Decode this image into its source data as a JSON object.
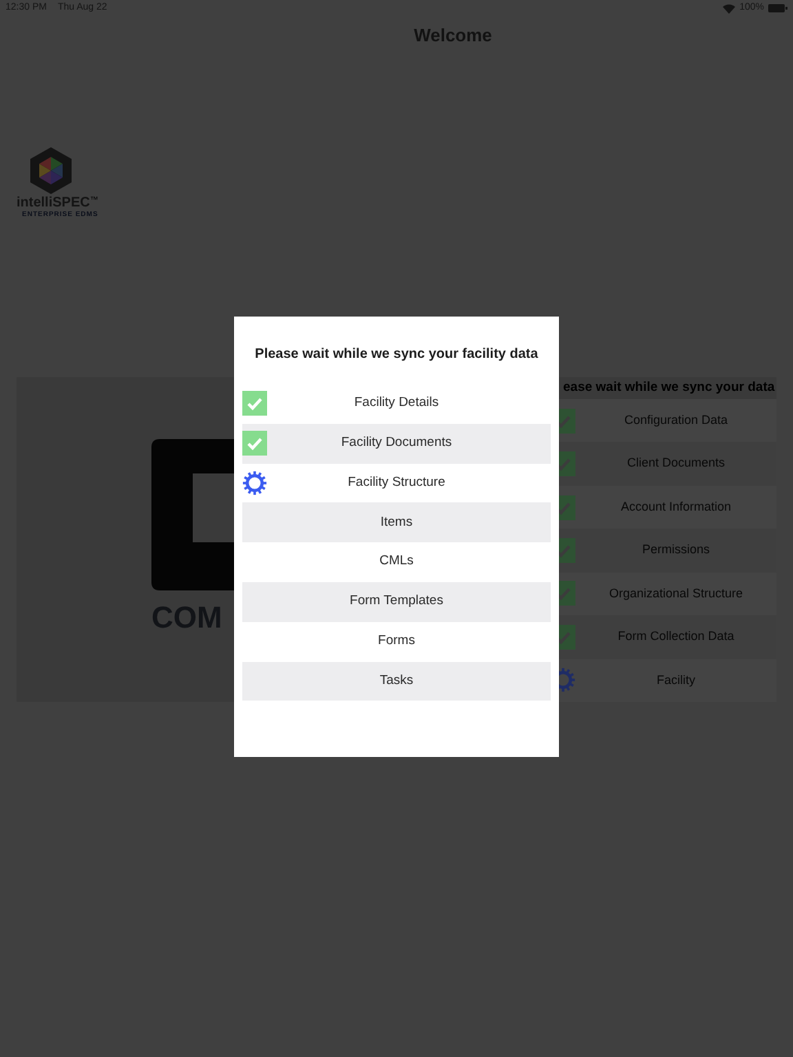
{
  "status_bar": {
    "time": "12:30 PM",
    "date": "Thu Aug 22",
    "battery": "100%"
  },
  "title": "Welcome",
  "logo": {
    "name": "intelliSPEC",
    "tm": "™",
    "tagline": "ENTERPRISE EDMS"
  },
  "background_panel": {
    "brand_text": "COM",
    "heading": "ease wait while we sync your data",
    "items": [
      {
        "label": "Configuration Data",
        "kind": "done"
      },
      {
        "label": "Client Documents",
        "kind": "done"
      },
      {
        "label": "Account Information",
        "kind": "done"
      },
      {
        "label": "Permissions",
        "kind": "done"
      },
      {
        "label": "Organizational Structure",
        "kind": "done"
      },
      {
        "label": "Form Collection Data",
        "kind": "done"
      },
      {
        "label": "Facility",
        "kind": "syncing"
      }
    ]
  },
  "dialog": {
    "title": "Please wait while we sync your facility data",
    "items": [
      {
        "label": "Facility Details",
        "kind": "done"
      },
      {
        "label": "Facility Documents",
        "kind": "done"
      },
      {
        "label": "Facility Structure",
        "kind": "syncing"
      },
      {
        "label": "Items",
        "kind": "pending"
      },
      {
        "label": "CMLs",
        "kind": "pending"
      },
      {
        "label": "Form Templates",
        "kind": "pending"
      },
      {
        "label": "Forms",
        "kind": "pending"
      },
      {
        "label": "Tasks",
        "kind": "pending"
      }
    ]
  }
}
